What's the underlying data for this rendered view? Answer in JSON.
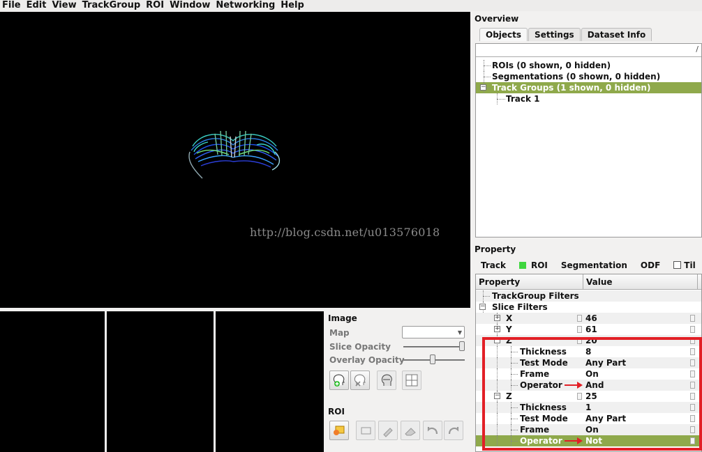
{
  "menu": [
    "File",
    "Edit",
    "View",
    "TrackGroup",
    "ROI",
    "Window",
    "Networking",
    "Help"
  ],
  "watermark": "http://blog.csdn.net/u013576018",
  "image_panel": {
    "title": "Image",
    "map_label": "Map",
    "slice_opacity_label": "Slice Opacity",
    "overlay_opacity_label": "Overlay Opacity",
    "slice_opacity_level": 0.95,
    "overlay_opacity_level": 0.45
  },
  "roi_panel": {
    "title": "ROI"
  },
  "overview": {
    "title": "Overview",
    "tabs": [
      "Objects",
      "Settings",
      "Dataset Info"
    ],
    "active_tab": "Objects",
    "path": "/",
    "tree": [
      {
        "label": "ROIs (0 shown, 0 hidden)",
        "level": 0,
        "expander": "",
        "selected": false
      },
      {
        "label": "Segmentations (0 shown, 0 hidden)",
        "level": 0,
        "expander": "",
        "selected": false
      },
      {
        "label": "Track Groups (1 shown, 0 hidden)",
        "level": 0,
        "expander": "minus",
        "selected": true
      },
      {
        "label": "Track 1",
        "level": 1,
        "expander": "",
        "selected": false
      }
    ]
  },
  "property": {
    "title": "Property",
    "tabs": [
      "Track",
      "ROI",
      "Segmentation",
      "ODF",
      "Til"
    ],
    "roi_indicator_color": "#3fd63f",
    "columns": [
      "Property",
      "Value"
    ],
    "rows": [
      {
        "key": "TrackGroup Filters",
        "value": "",
        "indent": 0,
        "expander": ""
      },
      {
        "key": "Slice Filters",
        "value": "",
        "indent": 0,
        "expander": "minus"
      },
      {
        "key": "X",
        "value": "46",
        "indent": 1,
        "expander": "plus"
      },
      {
        "key": "Y",
        "value": "61",
        "indent": 1,
        "expander": "plus"
      },
      {
        "key": "Z",
        "value": "20",
        "indent": 1,
        "expander": "minus"
      },
      {
        "key": "Thickness",
        "value": "8",
        "indent": 2,
        "expander": ""
      },
      {
        "key": "Test Mode",
        "value": "Any Part",
        "indent": 2,
        "expander": ""
      },
      {
        "key": "Frame",
        "value": "On",
        "indent": 2,
        "expander": ""
      },
      {
        "key": "Operator",
        "value": "And",
        "indent": 2,
        "expander": "",
        "arrow": true
      },
      {
        "key": "Z",
        "value": "25",
        "indent": 1,
        "expander": "minus"
      },
      {
        "key": "Thickness",
        "value": "1",
        "indent": 2,
        "expander": ""
      },
      {
        "key": "Test Mode",
        "value": "Any Part",
        "indent": 2,
        "expander": ""
      },
      {
        "key": "Frame",
        "value": "On",
        "indent": 2,
        "expander": ""
      },
      {
        "key": "Operator",
        "value": "Not",
        "indent": 2,
        "expander": "",
        "arrow": true,
        "selected": true
      }
    ]
  },
  "colors": {
    "selection": "#8fa94b",
    "highlight": "#e21f26"
  }
}
